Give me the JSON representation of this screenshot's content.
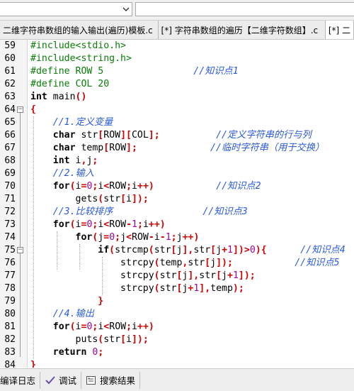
{
  "tabs": [
    {
      "label": "二维字符串数组的输入输出(遍历)模板.c",
      "active": false
    },
    {
      "label": "[*] 字符串数组的遍历【二维字符数组】.c",
      "active": false
    },
    {
      "label": "[*] 二",
      "active": true
    }
  ],
  "statusbar": {
    "items": [
      {
        "label": "编译日志",
        "icon": "compile-log-icon"
      },
      {
        "label": "调试",
        "icon": "check-icon"
      },
      {
        "label": "搜索结果",
        "icon": "search-results-icon"
      }
    ]
  },
  "colors": {
    "preprocessor": "#0a7d0a",
    "comment": "#2a5ad8",
    "number": "#a000a0",
    "symbol": "#d00000",
    "keyword": "#000000"
  },
  "editor": {
    "lines": [
      {
        "n": "59",
        "tokens": [
          {
            "t": "#include<stdio.h>",
            "c": "pp"
          }
        ]
      },
      {
        "n": "60",
        "tokens": [
          {
            "t": "#include<string.h>",
            "c": "pp"
          }
        ]
      },
      {
        "n": "61",
        "tokens": [
          {
            "t": "#define ROW 5",
            "c": "pp"
          },
          {
            "t": "                //知识点1",
            "c": "cm"
          }
        ]
      },
      {
        "n": "62",
        "tokens": [
          {
            "t": "#define COL 20",
            "c": "pp"
          }
        ]
      },
      {
        "n": "63",
        "tokens": [
          {
            "t": "int",
            "c": "kw"
          },
          {
            "t": " main",
            "c": "pl"
          },
          {
            "t": "()",
            "c": "op"
          }
        ]
      },
      {
        "n": "64",
        "tokens": [
          {
            "t": "{",
            "c": "op"
          }
        ]
      },
      {
        "n": "65",
        "tokens": [
          {
            "t": "    //1.定义变量",
            "c": "cm"
          }
        ]
      },
      {
        "n": "66",
        "tokens": [
          {
            "t": "    ",
            "c": "pl"
          },
          {
            "t": "char",
            "c": "kw"
          },
          {
            "t": " str",
            "c": "pl"
          },
          {
            "t": "[",
            "c": "op"
          },
          {
            "t": "ROW",
            "c": "pl"
          },
          {
            "t": "][",
            "c": "op"
          },
          {
            "t": "COL",
            "c": "pl"
          },
          {
            "t": "];",
            "c": "op"
          },
          {
            "t": "          //定义字符串的行与列",
            "c": "cm"
          }
        ]
      },
      {
        "n": "67",
        "tokens": [
          {
            "t": "    ",
            "c": "pl"
          },
          {
            "t": "char",
            "c": "kw"
          },
          {
            "t": " temp",
            "c": "pl"
          },
          {
            "t": "[",
            "c": "op"
          },
          {
            "t": "ROW",
            "c": "pl"
          },
          {
            "t": "];",
            "c": "op"
          },
          {
            "t": "             //临时字符串（用于交换）",
            "c": "cm"
          }
        ]
      },
      {
        "n": "68",
        "tokens": [
          {
            "t": "    ",
            "c": "pl"
          },
          {
            "t": "int",
            "c": "kw"
          },
          {
            "t": " i",
            "c": "pl"
          },
          {
            "t": ",",
            "c": "op"
          },
          {
            "t": "j",
            "c": "pl"
          },
          {
            "t": ";",
            "c": "op"
          }
        ]
      },
      {
        "n": "69",
        "tokens": [
          {
            "t": "    //2.输入",
            "c": "cm"
          }
        ]
      },
      {
        "n": "70",
        "tokens": [
          {
            "t": "    ",
            "c": "pl"
          },
          {
            "t": "for",
            "c": "kw"
          },
          {
            "t": "(",
            "c": "op"
          },
          {
            "t": "i",
            "c": "pl"
          },
          {
            "t": "=",
            "c": "op"
          },
          {
            "t": "0",
            "c": "num"
          },
          {
            "t": ";",
            "c": "op"
          },
          {
            "t": "i",
            "c": "pl"
          },
          {
            "t": "<",
            "c": "op"
          },
          {
            "t": "ROW",
            "c": "pl"
          },
          {
            "t": ";",
            "c": "op"
          },
          {
            "t": "i",
            "c": "pl"
          },
          {
            "t": "++)",
            "c": "op"
          },
          {
            "t": "           //知识点2",
            "c": "cm"
          }
        ]
      },
      {
        "n": "71",
        "tokens": [
          {
            "t": "        gets",
            "c": "pl"
          },
          {
            "t": "(",
            "c": "op"
          },
          {
            "t": "str",
            "c": "pl"
          },
          {
            "t": "[",
            "c": "op"
          },
          {
            "t": "i",
            "c": "pl"
          },
          {
            "t": "]);",
            "c": "op"
          }
        ]
      },
      {
        "n": "72",
        "tokens": [
          {
            "t": "    //3.比较排序",
            "c": "cm"
          },
          {
            "t": "                //知识点3",
            "c": "cm"
          }
        ]
      },
      {
        "n": "73",
        "tokens": [
          {
            "t": "    ",
            "c": "pl"
          },
          {
            "t": "for",
            "c": "kw"
          },
          {
            "t": "(",
            "c": "op"
          },
          {
            "t": "i",
            "c": "pl"
          },
          {
            "t": "=",
            "c": "op"
          },
          {
            "t": "0",
            "c": "num"
          },
          {
            "t": ";",
            "c": "op"
          },
          {
            "t": "i",
            "c": "pl"
          },
          {
            "t": "<",
            "c": "op"
          },
          {
            "t": "ROW",
            "c": "pl"
          },
          {
            "t": "-",
            "c": "op"
          },
          {
            "t": "1",
            "c": "num"
          },
          {
            "t": ";",
            "c": "op"
          },
          {
            "t": "i",
            "c": "pl"
          },
          {
            "t": "++)",
            "c": "op"
          }
        ]
      },
      {
        "n": "74",
        "tokens": [
          {
            "t": "        ",
            "c": "pl"
          },
          {
            "t": "for",
            "c": "kw"
          },
          {
            "t": "(",
            "c": "op"
          },
          {
            "t": "j",
            "c": "pl"
          },
          {
            "t": "=",
            "c": "op"
          },
          {
            "t": "0",
            "c": "num"
          },
          {
            "t": ";",
            "c": "op"
          },
          {
            "t": "j",
            "c": "pl"
          },
          {
            "t": "<",
            "c": "op"
          },
          {
            "t": "ROW",
            "c": "pl"
          },
          {
            "t": "-",
            "c": "op"
          },
          {
            "t": "i",
            "c": "pl"
          },
          {
            "t": "-",
            "c": "op"
          },
          {
            "t": "1",
            "c": "num"
          },
          {
            "t": ";",
            "c": "op"
          },
          {
            "t": "j",
            "c": "pl"
          },
          {
            "t": "++)",
            "c": "op"
          }
        ]
      },
      {
        "n": "75",
        "tokens": [
          {
            "t": "            ",
            "c": "pl"
          },
          {
            "t": "if",
            "c": "kw"
          },
          {
            "t": "(",
            "c": "op"
          },
          {
            "t": "strcmp",
            "c": "pl"
          },
          {
            "t": "(",
            "c": "op"
          },
          {
            "t": "str",
            "c": "pl"
          },
          {
            "t": "[",
            "c": "op"
          },
          {
            "t": "j",
            "c": "pl"
          },
          {
            "t": "],",
            "c": "op"
          },
          {
            "t": "str",
            "c": "pl"
          },
          {
            "t": "[",
            "c": "op"
          },
          {
            "t": "j",
            "c": "pl"
          },
          {
            "t": "+",
            "c": "op"
          },
          {
            "t": "1",
            "c": "num"
          },
          {
            "t": "])>",
            "c": "op"
          },
          {
            "t": "0",
            "c": "num"
          },
          {
            "t": "){",
            "c": "op"
          },
          {
            "t": "      //知识点4",
            "c": "cm"
          }
        ]
      },
      {
        "n": "76",
        "tokens": [
          {
            "t": "                strcpy",
            "c": "pl"
          },
          {
            "t": "(",
            "c": "op"
          },
          {
            "t": "temp",
            "c": "pl"
          },
          {
            "t": ",",
            "c": "op"
          },
          {
            "t": "str",
            "c": "pl"
          },
          {
            "t": "[",
            "c": "op"
          },
          {
            "t": "j",
            "c": "pl"
          },
          {
            "t": "]);",
            "c": "op"
          },
          {
            "t": "           //知识点5",
            "c": "cm"
          }
        ]
      },
      {
        "n": "77",
        "tokens": [
          {
            "t": "                strcpy",
            "c": "pl"
          },
          {
            "t": "(",
            "c": "op"
          },
          {
            "t": "str",
            "c": "pl"
          },
          {
            "t": "[",
            "c": "op"
          },
          {
            "t": "j",
            "c": "pl"
          },
          {
            "t": "],",
            "c": "op"
          },
          {
            "t": "str",
            "c": "pl"
          },
          {
            "t": "[",
            "c": "op"
          },
          {
            "t": "j",
            "c": "pl"
          },
          {
            "t": "+",
            "c": "op"
          },
          {
            "t": "1",
            "c": "num"
          },
          {
            "t": "]);",
            "c": "op"
          }
        ]
      },
      {
        "n": "78",
        "tokens": [
          {
            "t": "                strcpy",
            "c": "pl"
          },
          {
            "t": "(",
            "c": "op"
          },
          {
            "t": "str",
            "c": "pl"
          },
          {
            "t": "[",
            "c": "op"
          },
          {
            "t": "j",
            "c": "pl"
          },
          {
            "t": "+",
            "c": "op"
          },
          {
            "t": "1",
            "c": "num"
          },
          {
            "t": "],",
            "c": "op"
          },
          {
            "t": "temp",
            "c": "pl"
          },
          {
            "t": ");",
            "c": "op"
          }
        ]
      },
      {
        "n": "79",
        "tokens": [
          {
            "t": "            ",
            "c": "pl"
          },
          {
            "t": "}",
            "c": "op"
          }
        ]
      },
      {
        "n": "80",
        "tokens": [
          {
            "t": "    //4.输出",
            "c": "cm"
          }
        ]
      },
      {
        "n": "81",
        "tokens": [
          {
            "t": "    ",
            "c": "pl"
          },
          {
            "t": "for",
            "c": "kw"
          },
          {
            "t": "(",
            "c": "op"
          },
          {
            "t": "i",
            "c": "pl"
          },
          {
            "t": "=",
            "c": "op"
          },
          {
            "t": "0",
            "c": "num"
          },
          {
            "t": ";",
            "c": "op"
          },
          {
            "t": "i",
            "c": "pl"
          },
          {
            "t": "<",
            "c": "op"
          },
          {
            "t": "ROW",
            "c": "pl"
          },
          {
            "t": ";",
            "c": "op"
          },
          {
            "t": "i",
            "c": "pl"
          },
          {
            "t": "++)",
            "c": "op"
          }
        ]
      },
      {
        "n": "82",
        "tokens": [
          {
            "t": "        puts",
            "c": "pl"
          },
          {
            "t": "(",
            "c": "op"
          },
          {
            "t": "str",
            "c": "pl"
          },
          {
            "t": "[",
            "c": "op"
          },
          {
            "t": "i",
            "c": "pl"
          },
          {
            "t": "]);",
            "c": "op"
          }
        ]
      },
      {
        "n": "83",
        "tokens": [
          {
            "t": "    ",
            "c": "pl"
          },
          {
            "t": "return",
            "c": "kw"
          },
          {
            "t": " ",
            "c": "pl"
          },
          {
            "t": "0",
            "c": "num"
          },
          {
            "t": ";",
            "c": "op"
          }
        ]
      },
      {
        "n": "84",
        "tokens": [
          {
            "t": "}",
            "c": "op"
          }
        ]
      }
    ]
  }
}
